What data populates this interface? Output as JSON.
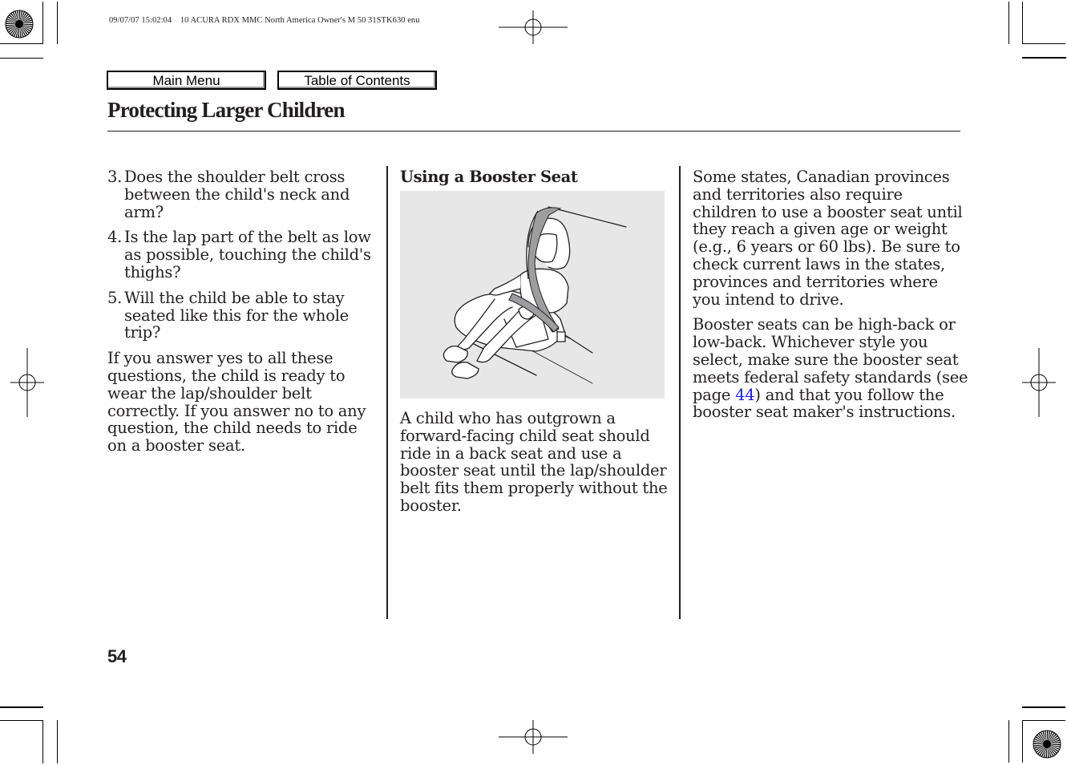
{
  "print_header": "09/07/07 15:02:04    10 ACURA RDX MMC North America Owner's M 50 31STK630 enu",
  "nav": {
    "main_menu_label": "Main Menu",
    "toc_label": "Table of Contents"
  },
  "page": {
    "title": "Protecting Larger Children",
    "number": "54"
  },
  "column1": {
    "items": [
      {
        "num": "3.",
        "text": "Does the shoulder belt cross between the child's neck and arm?"
      },
      {
        "num": "4.",
        "text": "Is the lap part of the belt as low as possible, touching the child's thighs?"
      },
      {
        "num": "5.",
        "text": "Will the child be able to stay seated like this for the whole trip?"
      }
    ],
    "paragraph": "If you answer yes to all these questions, the child is ready to wear the lap/shoulder belt correctly. If you answer no to any question, the child needs to ride on a booster seat."
  },
  "column2": {
    "heading": "Using a Booster Seat",
    "illustration": "child-in-booster-seat-illustration",
    "paragraph": "A child who has outgrown a forward-facing child seat should ride in a back seat and use a booster seat until the lap/shoulder belt fits them properly without the booster."
  },
  "column3": {
    "paragraph1": "Some states, Canadian provinces and territories also require children to use a booster seat until they reach a given age or weight (e.g., 6 years or 60 lbs). Be sure to check current laws in the states, provinces and territories where you intend to drive.",
    "paragraph2_before": "Booster seats can be high-back or low-back. Whichever style you select, make sure the booster seat meets federal safety standards (see page ",
    "paragraph2_link": "44",
    "paragraph2_after": ") and that you follow the booster seat maker's instructions."
  },
  "colors": {
    "text": "#231f20",
    "link": "#1a1aff",
    "illustration_bg": "#e7e7e8"
  }
}
